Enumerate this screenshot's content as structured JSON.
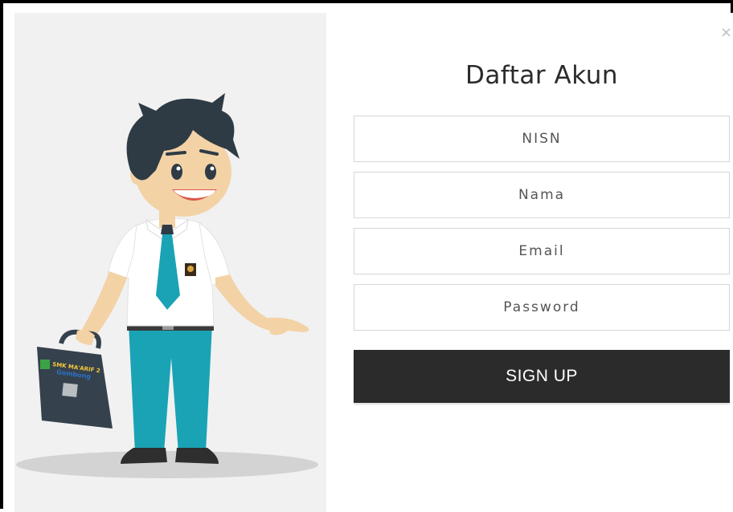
{
  "modal": {
    "close_symbol": "×",
    "title": "Daftar Akun",
    "fields": {
      "nisn_placeholder": "NISN",
      "nama_placeholder": "Nama",
      "email_placeholder": "Email",
      "password_placeholder": "Password"
    },
    "signup_label": "SIGN UP"
  },
  "illustration": {
    "bag_logo_line1": "SMK MA'ARIF 2",
    "bag_logo_line2": "Gombong",
    "colors": {
      "background": "#f1f1f1",
      "hair": "#2e3b45",
      "skin": "#f3d2a6",
      "shirt": "#ffffff",
      "tie": "#1aa3b5",
      "pants": "#1aa3b5",
      "bag": "#35414c",
      "shadow": "#d3d3d3",
      "button": "#2b2b2b"
    }
  }
}
